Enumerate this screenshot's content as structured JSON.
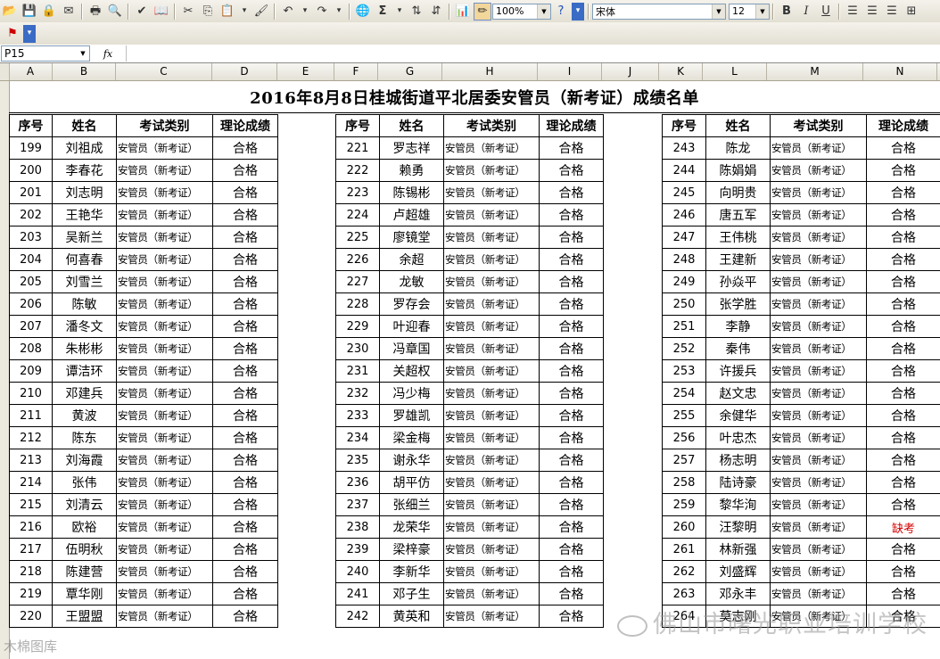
{
  "toolbar": {
    "zoom": "100%",
    "font_name": "宋体",
    "font_size": "12"
  },
  "name_box": "P15",
  "fx_label": "fx",
  "columns": [
    "A",
    "B",
    "C",
    "D",
    "E",
    "F",
    "G",
    "H",
    "I",
    "J",
    "K",
    "L",
    "M",
    "N"
  ],
  "title": "2016年8月8日桂城街道平北居委安管员（新考证）成绩名单",
  "headers": {
    "seq": "序号",
    "name": "姓名",
    "type": "考试类别",
    "score": "理论成绩"
  },
  "exam_type": "安管员（新考证）",
  "block1": [
    {
      "seq": "199",
      "name": "刘祖成",
      "score": "合格"
    },
    {
      "seq": "200",
      "name": "李春花",
      "score": "合格"
    },
    {
      "seq": "201",
      "name": "刘志明",
      "score": "合格"
    },
    {
      "seq": "202",
      "name": "王艳华",
      "score": "合格"
    },
    {
      "seq": "203",
      "name": "吴新兰",
      "score": "合格"
    },
    {
      "seq": "204",
      "name": "何喜春",
      "score": "合格"
    },
    {
      "seq": "205",
      "name": "刘雪兰",
      "score": "合格"
    },
    {
      "seq": "206",
      "name": "陈敏",
      "score": "合格"
    },
    {
      "seq": "207",
      "name": "潘冬文",
      "score": "合格"
    },
    {
      "seq": "208",
      "name": "朱彬彬",
      "score": "合格"
    },
    {
      "seq": "209",
      "name": "谭洁环",
      "score": "合格"
    },
    {
      "seq": "210",
      "name": "邓建兵",
      "score": "合格"
    },
    {
      "seq": "211",
      "name": "黄波",
      "score": "合格"
    },
    {
      "seq": "212",
      "name": "陈东",
      "score": "合格"
    },
    {
      "seq": "213",
      "name": "刘海霞",
      "score": "合格"
    },
    {
      "seq": "214",
      "name": "张伟",
      "score": "合格"
    },
    {
      "seq": "215",
      "name": "刘清云",
      "score": "合格"
    },
    {
      "seq": "216",
      "name": "欧裕",
      "score": "合格"
    },
    {
      "seq": "217",
      "name": "伍明秋",
      "score": "合格"
    },
    {
      "seq": "218",
      "name": "陈建营",
      "score": "合格"
    },
    {
      "seq": "219",
      "name": "覃华刚",
      "score": "合格"
    },
    {
      "seq": "220",
      "name": "王盟盟",
      "score": "合格"
    }
  ],
  "block2": [
    {
      "seq": "221",
      "name": "罗志祥",
      "score": "合格"
    },
    {
      "seq": "222",
      "name": "赖勇",
      "score": "合格"
    },
    {
      "seq": "223",
      "name": "陈锡彬",
      "score": "合格"
    },
    {
      "seq": "224",
      "name": "卢超雄",
      "score": "合格"
    },
    {
      "seq": "225",
      "name": "廖镜堂",
      "score": "合格"
    },
    {
      "seq": "226",
      "name": "余超",
      "score": "合格"
    },
    {
      "seq": "227",
      "name": "龙敏",
      "score": "合格"
    },
    {
      "seq": "228",
      "name": "罗存会",
      "score": "合格"
    },
    {
      "seq": "229",
      "name": "叶迎春",
      "score": "合格"
    },
    {
      "seq": "230",
      "name": "冯章国",
      "score": "合格"
    },
    {
      "seq": "231",
      "name": "关超权",
      "score": "合格"
    },
    {
      "seq": "232",
      "name": "冯少梅",
      "score": "合格"
    },
    {
      "seq": "233",
      "name": "罗雄凯",
      "score": "合格"
    },
    {
      "seq": "234",
      "name": "梁金梅",
      "score": "合格"
    },
    {
      "seq": "235",
      "name": "谢永华",
      "score": "合格"
    },
    {
      "seq": "236",
      "name": "胡平仿",
      "score": "合格"
    },
    {
      "seq": "237",
      "name": "张细兰",
      "score": "合格"
    },
    {
      "seq": "238",
      "name": "龙荣华",
      "score": "合格"
    },
    {
      "seq": "239",
      "name": "梁梓豪",
      "score": "合格"
    },
    {
      "seq": "240",
      "name": "李新华",
      "score": "合格"
    },
    {
      "seq": "241",
      "name": "邓子生",
      "score": "合格"
    },
    {
      "seq": "242",
      "name": "黄英和",
      "score": "合格"
    }
  ],
  "block3": [
    {
      "seq": "243",
      "name": "陈龙",
      "score": "合格"
    },
    {
      "seq": "244",
      "name": "陈娟娟",
      "score": "合格"
    },
    {
      "seq": "245",
      "name": "向明贵",
      "score": "合格"
    },
    {
      "seq": "246",
      "name": "唐五军",
      "score": "合格"
    },
    {
      "seq": "247",
      "name": "王伟桃",
      "score": "合格"
    },
    {
      "seq": "248",
      "name": "王建新",
      "score": "合格"
    },
    {
      "seq": "249",
      "name": "孙焱平",
      "score": "合格"
    },
    {
      "seq": "250",
      "name": "张学胜",
      "score": "合格"
    },
    {
      "seq": "251",
      "name": "李静",
      "score": "合格"
    },
    {
      "seq": "252",
      "name": "秦伟",
      "score": "合格"
    },
    {
      "seq": "253",
      "name": "许援兵",
      "score": "合格"
    },
    {
      "seq": "254",
      "name": "赵文忠",
      "score": "合格"
    },
    {
      "seq": "255",
      "name": "余健华",
      "score": "合格"
    },
    {
      "seq": "256",
      "name": "叶忠杰",
      "score": "合格"
    },
    {
      "seq": "257",
      "name": "杨志明",
      "score": "合格"
    },
    {
      "seq": "258",
      "name": "陆诗豪",
      "score": "合格"
    },
    {
      "seq": "259",
      "name": "黎华洵",
      "score": "合格"
    },
    {
      "seq": "260",
      "name": "汪黎明",
      "score": "缺考",
      "absent": true
    },
    {
      "seq": "261",
      "name": "林新强",
      "score": "合格"
    },
    {
      "seq": "262",
      "name": "刘盛辉",
      "score": "合格"
    },
    {
      "seq": "263",
      "name": "邓永丰",
      "score": "合格"
    },
    {
      "seq": "264",
      "name": "莫志刚",
      "score": "合格"
    }
  ],
  "watermarks": {
    "main": "佛山市曙光职业培训学校",
    "corner": "木棉图库"
  },
  "colors": {
    "absent": "#d40000"
  }
}
